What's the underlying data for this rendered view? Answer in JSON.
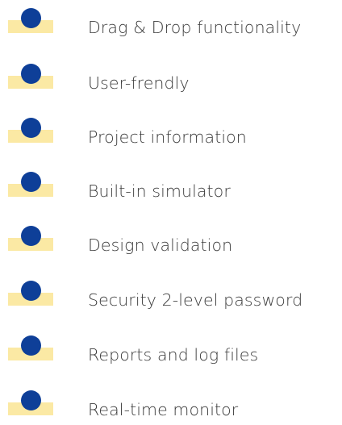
{
  "colors": {
    "bar": "#fbe9a4",
    "dot": "#0e3f98",
    "text": "#3a3a3a"
  },
  "features": [
    {
      "label": "Drag & Drop functionality",
      "icon": "bullet-icon"
    },
    {
      "label": "User-frendly",
      "icon": "bullet-icon"
    },
    {
      "label": "Project information",
      "icon": "bullet-icon"
    },
    {
      "label": "Built-in simulator",
      "icon": "bullet-icon"
    },
    {
      "label": "Design validation",
      "icon": "bullet-icon"
    },
    {
      "label": "Security 2-level password",
      "icon": "bullet-icon"
    },
    {
      "label": "Reports and log files",
      "icon": "bullet-icon"
    },
    {
      "label": "Real-time monitor",
      "icon": "bullet-icon"
    }
  ]
}
